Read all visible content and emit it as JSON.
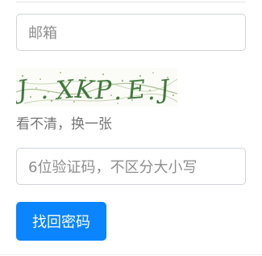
{
  "form": {
    "email_placeholder": "邮箱",
    "captcha": {
      "text": "J XKP E J",
      "refresh_label": "看不清，换一张"
    },
    "code_placeholder": "6位验证码，不区分大小写",
    "submit_label": "找回密码"
  },
  "colors": {
    "primary": "#0a84ff",
    "border": "#cfd4da",
    "captcha_ink": "#2f6b2a",
    "captcha_bg": "#fbfcf7"
  }
}
